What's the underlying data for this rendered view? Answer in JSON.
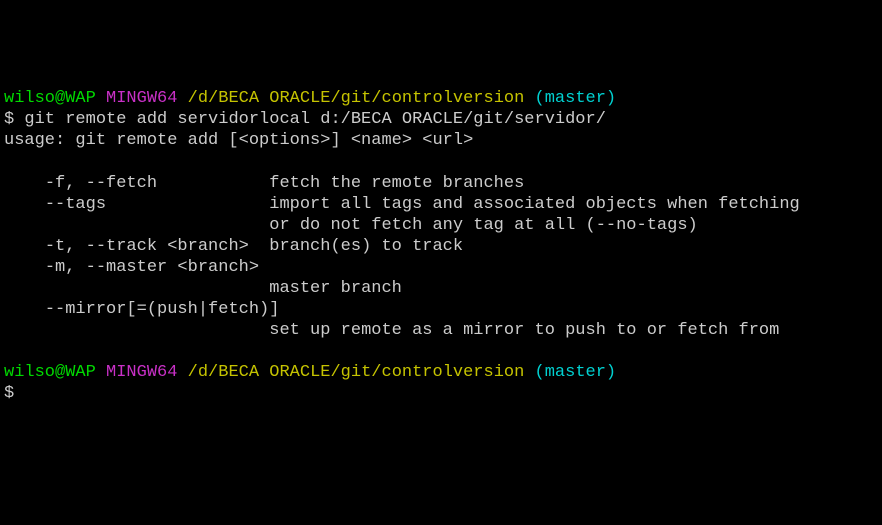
{
  "prompt1": {
    "user_host": "wilso@WAP",
    "shell": "MINGW64",
    "path": "/d/BECA ORACLE/git/controlversion",
    "branch": "(master)"
  },
  "cmd1_marker": "$ ",
  "cmd1": "git remote add servidorlocal d:/BECA ORACLE/git/servidor/",
  "out": {
    "l0": "usage: git remote add [<options>] <name> <url>",
    "l1": "",
    "l2": "    -f, --fetch           fetch the remote branches",
    "l3": "    --tags                import all tags and associated objects when fetching",
    "l4": "                          or do not fetch any tag at all (--no-tags)",
    "l5": "    -t, --track <branch>  branch(es) to track",
    "l6": "    -m, --master <branch>",
    "l7": "                          master branch",
    "l8": "    --mirror[=(push|fetch)]",
    "l9": "                          set up remote as a mirror to push to or fetch from",
    "l10": ""
  },
  "prompt2": {
    "user_host": "wilso@WAP",
    "shell": "MINGW64",
    "path": "/d/BECA ORACLE/git/controlversion",
    "branch": "(master)"
  },
  "cmd2_marker": "$ "
}
